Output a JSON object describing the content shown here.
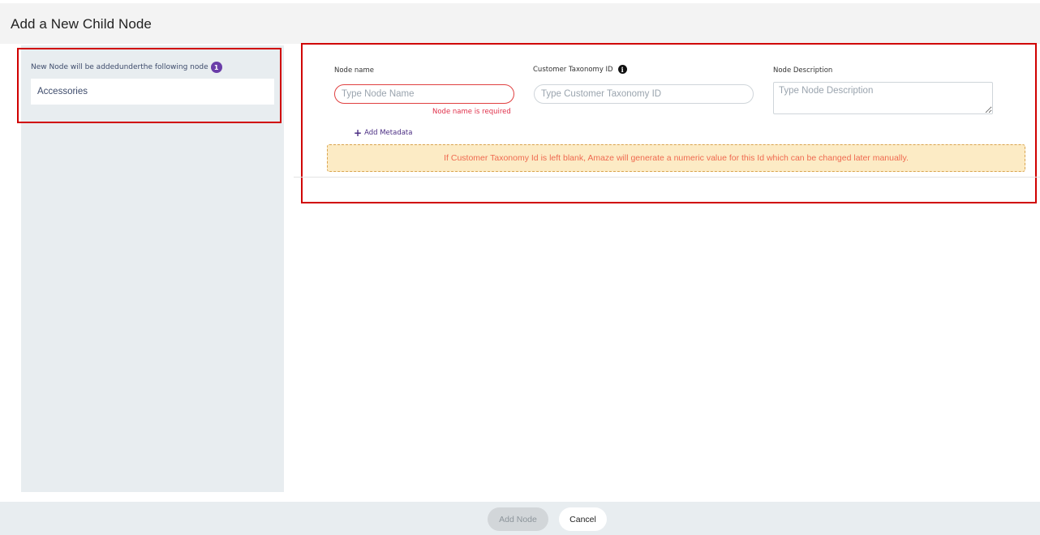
{
  "dialog": {
    "title": "Add a New Child Node"
  },
  "parent": {
    "caption": "New Node will be addedunderthe following node",
    "badge": "1",
    "node_name": "Accessories"
  },
  "form": {
    "node_name": {
      "label": "Node name",
      "placeholder": "Type Node Name",
      "value": "",
      "error": "Node name is required"
    },
    "taxonomy_id": {
      "label": "Customer Taxonomy ID",
      "info_icon": "i",
      "placeholder": "Type Customer Taxonomy ID",
      "value": ""
    },
    "description": {
      "label": "Node Description",
      "placeholder": "Type Node Description",
      "value": ""
    },
    "add_metadata": {
      "icon": "+",
      "label": "Add Metadata"
    },
    "notice": "If Customer Taxonomy Id is left blank, Amaze will generate a numeric value for this Id which can be changed later manually."
  },
  "footer": {
    "add_label": "Add Node",
    "cancel_label": "Cancel"
  },
  "colors": {
    "highlight_border": "#d00000",
    "accent": "#6a3da8",
    "error": "#e0304a",
    "notice_bg": "#fcebc5",
    "notice_text": "#ef6a50"
  }
}
